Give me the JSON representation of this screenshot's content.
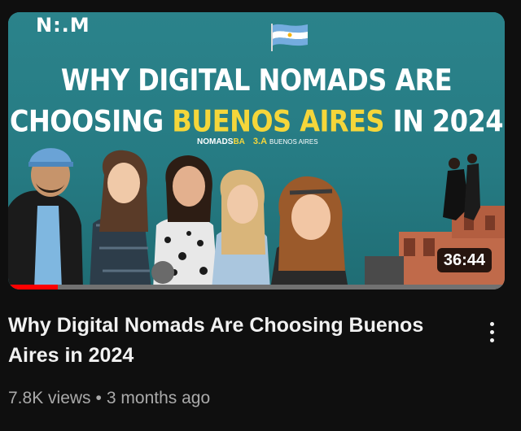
{
  "video": {
    "title": "Why Digital Nomads Are Choosing Buenos Aires in 2024",
    "views": "7.8K views",
    "separator": "•",
    "age": "3 months ago",
    "duration": "36:44",
    "watch_progress_percent": 10
  },
  "thumbnail": {
    "logo_text": "N:.M",
    "headline_line1": "WHY DIGITAL NOMADS ARE",
    "headline_line2_pre": "CHOOSING ",
    "headline_line2_highlight": "BUENOS AIRES",
    "headline_line2_post": " IN 2024",
    "sponsor_1_main": "NOMADS",
    "sponsor_1_suffix": "BA",
    "sponsor_2_dots": "3.A",
    "sponsor_2_text": "BUENOS AIRES",
    "colors": {
      "background": "#2a7f86",
      "highlight": "#f5d63a",
      "progress": "#ff0000"
    }
  },
  "menu": {
    "icon": "more-vert-icon"
  }
}
